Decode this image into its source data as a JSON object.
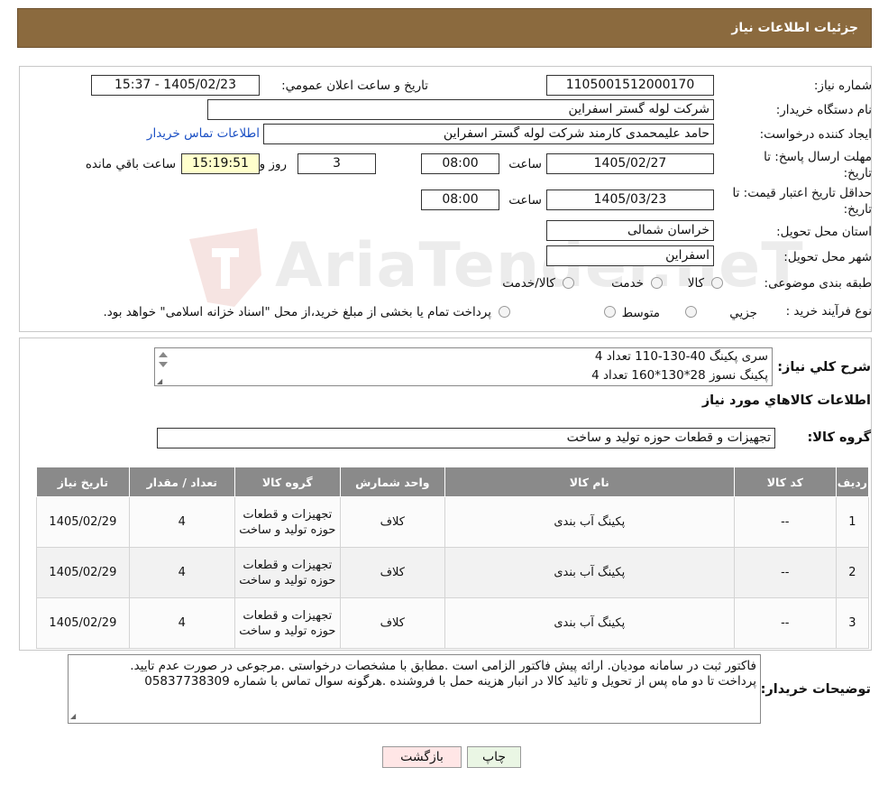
{
  "header": {
    "title": "جزئیات اطلاعات نیاز"
  },
  "fields": {
    "need_number_label": "شماره نیاز:",
    "need_number": "1105001512000170",
    "announce_label": "تاریخ و ساعت اعلان عمومي:",
    "announce_value": "1405/02/23 - 15:37",
    "buyer_label": "نام دستگاه خریدار:",
    "buyer_value": "شرکت لوله گستر اسفراين",
    "creator_label": "ایجاد کننده درخواست:",
    "creator_value": "حامد علیمحمدی کارمند شرکت لوله گستر اسفراين",
    "contact_link": "اطلاعات تماس خریدار",
    "deadline_label_1": "مهلت ارسال پاسخ: تا",
    "deadline_label_2": "تاریخ:",
    "deadline_date": "1405/02/27",
    "time_label": "ساعت",
    "deadline_time": "08:00",
    "days_value": "3",
    "days_label": "روز و",
    "remaining_time": "15:19:51",
    "remaining_label": "ساعت باقي مانده",
    "validity_label_1": "حداقل تاریخ اعتبار قیمت: تا",
    "validity_label_2": "تاریخ:",
    "validity_date": "1405/03/23",
    "validity_time": "08:00",
    "province_label": "استان محل تحویل:",
    "province_value": "خراسان شمالی",
    "city_label": "شهر محل تحویل:",
    "city_value": "اسفراين",
    "category_label": "طبقه بندی موضوعی:",
    "category_options": [
      "کالا",
      "خدمت",
      "کالا/خدمت"
    ],
    "process_label": "نوع فرآیند خرید :",
    "process_options": [
      "جزیي",
      "متوسط"
    ],
    "process_note": "پرداخت تمام یا بخشی از مبلغ خرید،از محل \"اسناد خزانه اسلامی\" خواهد بود."
  },
  "description": {
    "label": "شرح كلي نياز:",
    "lines": [
      "سری پکینگ 40-130-110 تعداد 4",
      "پکینگ نسوز 28*130*160 تعداد 4"
    ]
  },
  "goods": {
    "section_title": "اطلاعات كالاهاي مورد نياز",
    "group_label": "گروه كالا:",
    "group_value": "تجهیزات و قطعات حوزه تولید و ساخت"
  },
  "table": {
    "headers": [
      "رديف",
      "کد کالا",
      "نام کالا",
      "واحد شمارش",
      "گروه کالا",
      "تعداد / مقدار",
      "تاریخ نیاز"
    ],
    "rows": [
      [
        "1",
        "--",
        "پکینگ آب بندی",
        "کلاف",
        "تجهیزات و قطعات حوزه تولید و ساخت",
        "4",
        "1405/02/29"
      ],
      [
        "2",
        "--",
        "پکینگ آب بندی",
        "کلاف",
        "تجهیزات و قطعات حوزه تولید و ساخت",
        "4",
        "1405/02/29"
      ],
      [
        "3",
        "--",
        "پکینگ آب بندی",
        "کلاف",
        "تجهیزات و قطعات حوزه تولید و ساخت",
        "4",
        "1405/02/29"
      ]
    ]
  },
  "buyer_notes": {
    "label": "توضیحات خریدار:",
    "lines": [
      "فاکتور ثبت در سامانه مودیان. ارائه پیش فاکتور الزامی است .مطابق با مشخصات درخواستی .مرجوعی در صورت عدم تایید.",
      "پرداخت تا دو ماه پس از تحویل و تائید کالا در انبار  هزینه حمل با فروشنده .هرگونه سوال تماس با شماره 05837738309"
    ]
  },
  "buttons": {
    "print": "چاپ",
    "back": "بازگشت"
  },
  "watermark": {
    "text": "AriaTender.neT"
  },
  "colors": {
    "header_bg": "#8b6a3e",
    "link": "#1a4fc4",
    "table_header": "#8a8a8a",
    "remaining_bg": "#ffffcc",
    "back_button_bg": "#ffe6e6"
  }
}
